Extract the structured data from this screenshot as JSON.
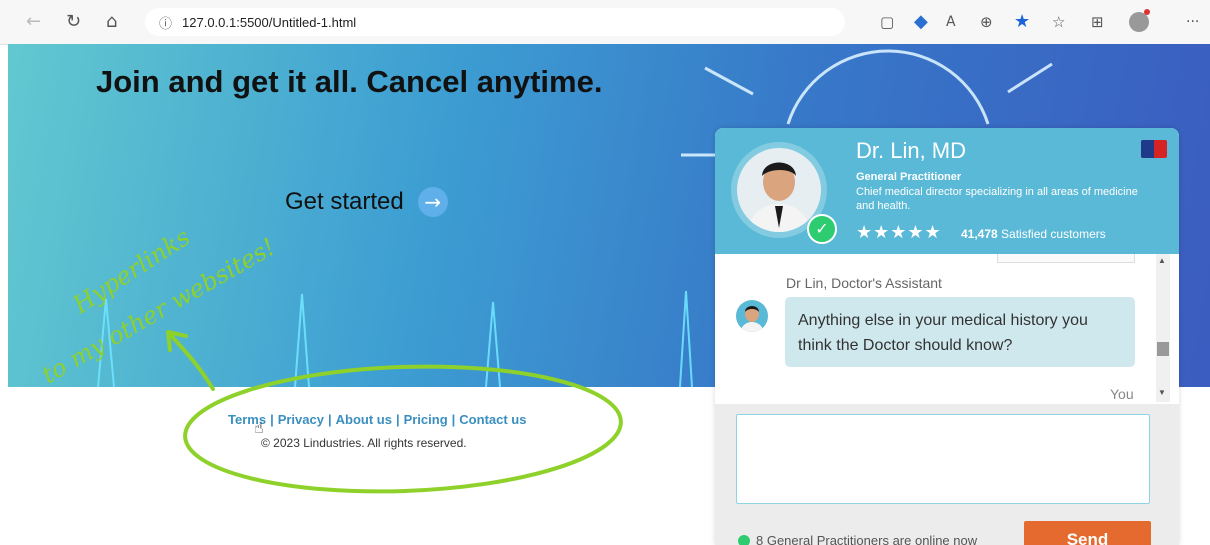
{
  "browser": {
    "url": "127.0.0.1:5500/Untitled-1.html",
    "nav_icons": [
      "back-icon",
      "refresh-icon",
      "home-icon"
    ],
    "toolbar_icons": [
      "tab-actions-icon",
      "tag-icon",
      "read-aloud-icon",
      "zoom-icon",
      "favorite-star-icon",
      "favorites-list-icon",
      "collections-icon",
      "profile-icon",
      "more-icon"
    ],
    "more_label": "···"
  },
  "hero": {
    "title": "Join and get it all. Cancel anytime.",
    "cta_label": "Get started",
    "cta_arrow": "→"
  },
  "footer": {
    "links": [
      "Terms",
      "Privacy",
      "About us",
      "Pricing",
      "Contact us"
    ],
    "separator": "|",
    "copyright": "© 2023 Lindustries. All rights reserved."
  },
  "annotation": {
    "line1": "Hyperlinks",
    "line2": "to my other websites!",
    "color": "#8ed12a"
  },
  "chat": {
    "doctor_name": "Dr. Lin, MD",
    "specialty": "General Practitioner",
    "description": "Chief medical director specializing in all areas of medicine and health.",
    "rating_stars": "★★★★★",
    "rating": 5,
    "customer_count": "41,478",
    "customer_label": "Satisfied customers",
    "sender": "Dr Lin, Doctor's Assistant",
    "message": "Anything else in your medical history you think the Doctor should know?",
    "you_label": "You",
    "input_placeholder": "",
    "online_text": "8 General Practitioners are online now",
    "send_label": "Send",
    "header_color": "#5ab9d6",
    "send_color": "#e46a2f"
  }
}
